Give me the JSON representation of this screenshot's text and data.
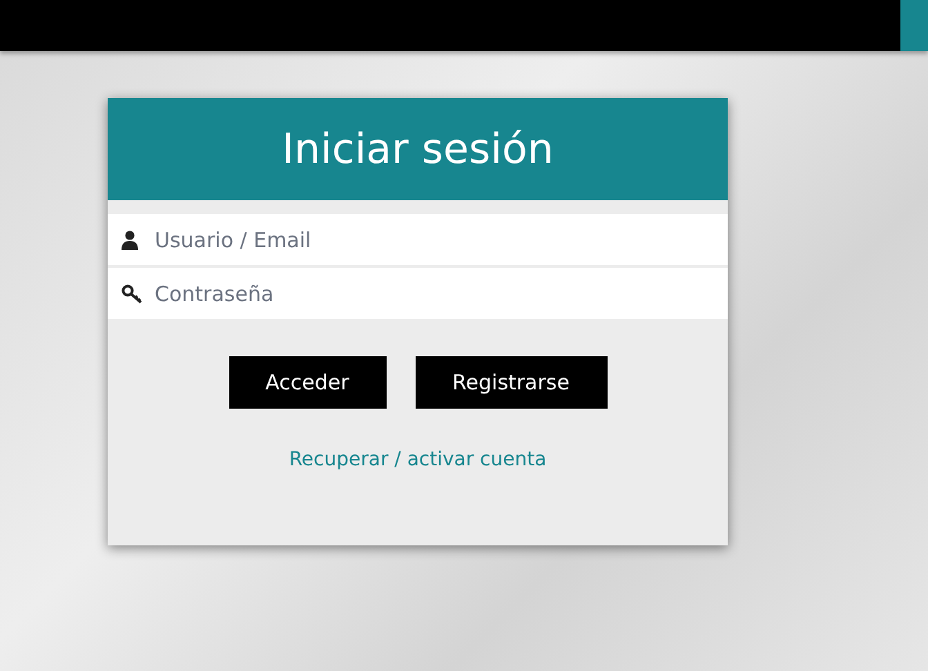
{
  "login": {
    "title": "Iniciar sesión",
    "fields": [
      {
        "kind": "user",
        "placeholder": "Usuario / Email"
      },
      {
        "kind": "password",
        "placeholder": "Contraseña"
      }
    ],
    "buttons": [
      "Acceder",
      "Registrarse"
    ],
    "link": "Recuperar / activar cuenta"
  }
}
